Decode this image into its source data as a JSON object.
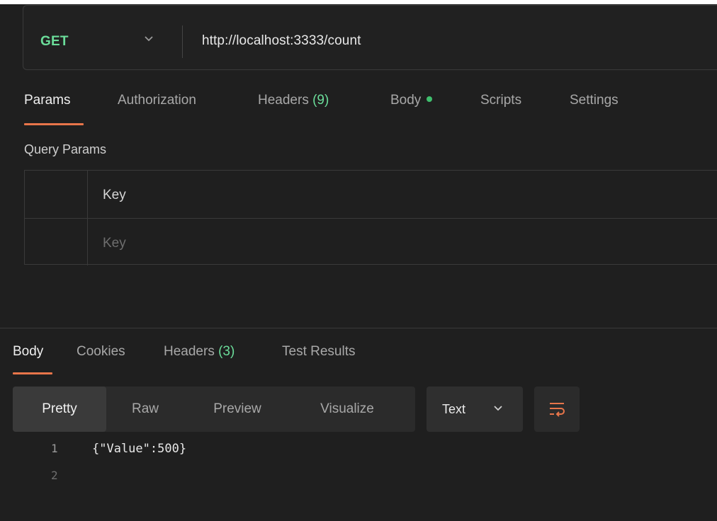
{
  "request": {
    "method": "GET",
    "url": "http://localhost:3333/count"
  },
  "request_tabs": {
    "params": "Params",
    "authorization": "Authorization",
    "headers_label": "Headers",
    "headers_count": "(9)",
    "body": "Body",
    "scripts": "Scripts",
    "settings": "Settings"
  },
  "query_params": {
    "title": "Query Params",
    "header_key": "Key",
    "key_placeholder": "Key"
  },
  "response_tabs": {
    "body": "Body",
    "cookies": "Cookies",
    "headers_label": "Headers",
    "headers_count": "(3)",
    "test_results": "Test Results"
  },
  "view_modes": {
    "pretty": "Pretty",
    "raw": "Raw",
    "preview": "Preview",
    "visualize": "Visualize",
    "format": "Text"
  },
  "response_body": {
    "lines": [
      {
        "num": "1",
        "text": "{\"Value\":500}"
      },
      {
        "num": "2",
        "text": ""
      }
    ]
  },
  "colors": {
    "method": "#6bdd9a",
    "accent": "#e8754a",
    "active_dot": "#3fbf6d"
  },
  "icons": {
    "method_dropdown": "chevron-down-icon",
    "format_dropdown": "chevron-down-icon",
    "wrap": "wrap-lines-icon",
    "body_status": "dot-icon"
  }
}
